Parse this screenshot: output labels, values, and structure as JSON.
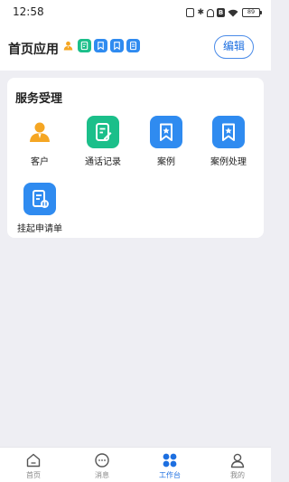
{
  "status_bar": {
    "time": "12:58",
    "battery": "89",
    "icons": [
      "nfc-icon",
      "bluetooth-icon",
      "bell-icon",
      "b-icon",
      "wifi-icon",
      "battery-icon"
    ]
  },
  "header": {
    "title": "首页应用",
    "edit_label": "编辑",
    "mini_icons": [
      "person-icon",
      "call-record-icon",
      "bookmark-icon",
      "bookmark-icon",
      "document-icon"
    ]
  },
  "service": {
    "title": "服务受理",
    "items": [
      {
        "label": "客户",
        "icon": "person-icon"
      },
      {
        "label": "通话记录",
        "icon": "call-record-icon"
      },
      {
        "label": "案例",
        "icon": "bookmark-star-icon"
      },
      {
        "label": "案例处理",
        "icon": "bookmark-star-icon"
      },
      {
        "label": "挂起申请单",
        "icon": "document-pause-icon"
      }
    ]
  },
  "tabbar": {
    "tabs": [
      {
        "label": "首页",
        "icon": "home-icon",
        "active": false
      },
      {
        "label": "消息",
        "icon": "message-icon",
        "active": false
      },
      {
        "label": "工作台",
        "icon": "grid-icon",
        "active": true
      },
      {
        "label": "我的",
        "icon": "profile-icon",
        "active": false
      }
    ]
  },
  "colors": {
    "primary": "#1D6FE0",
    "app_blue": "#2F8BF0",
    "app_green": "#1BBF8A",
    "app_orange": "#F5A623",
    "background": "#EEEEF3"
  }
}
